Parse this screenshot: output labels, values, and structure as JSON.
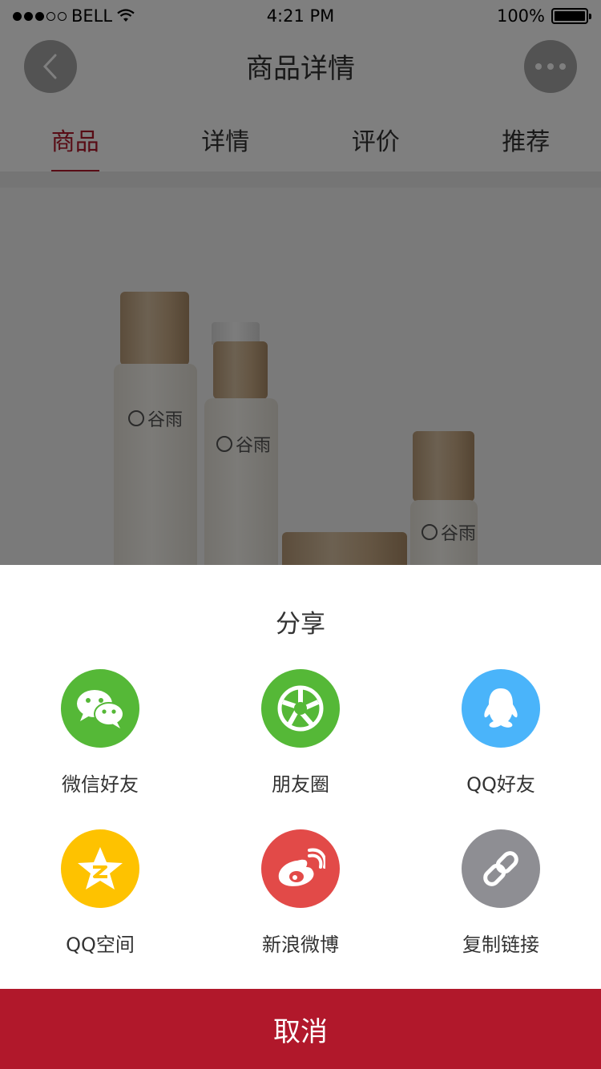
{
  "status_bar": {
    "carrier": "BELL",
    "time": "4:21 PM",
    "battery": "100%"
  },
  "header": {
    "title": "商品详情"
  },
  "tabs": [
    {
      "label": "商品",
      "active": true
    },
    {
      "label": "详情",
      "active": false
    },
    {
      "label": "评价",
      "active": false
    },
    {
      "label": "推荐",
      "active": false
    }
  ],
  "product": {
    "brand_text": "谷雨"
  },
  "share_sheet": {
    "title": "分享",
    "items": [
      {
        "label": "微信好友",
        "icon": "wechat-icon",
        "color": "#55b837"
      },
      {
        "label": "朋友圈",
        "icon": "moments-icon",
        "color": "#55b837"
      },
      {
        "label": "QQ好友",
        "icon": "qq-icon",
        "color": "#4ab4fa"
      },
      {
        "label": "QQ空间",
        "icon": "qzone-icon",
        "color": "#fec200"
      },
      {
        "label": "新浪微博",
        "icon": "weibo-icon",
        "color": "#e24a48"
      },
      {
        "label": "复制链接",
        "icon": "link-icon",
        "color": "#8e8e93"
      }
    ],
    "cancel_label": "取消"
  },
  "colors": {
    "accent": "#b1182b",
    "overlay": "rgba(0,0,0,0.5)"
  }
}
